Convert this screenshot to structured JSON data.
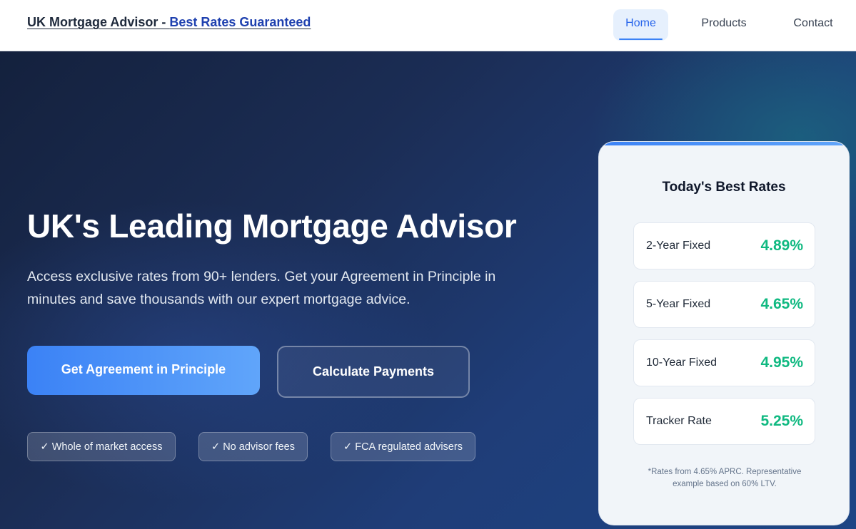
{
  "header": {
    "brand_prefix": "UK Mortgage Advisor - ",
    "brand_accent": "Best Rates Guaranteed",
    "nav": [
      {
        "label": "Home"
      },
      {
        "label": "Products"
      },
      {
        "label": "Contact"
      }
    ]
  },
  "hero": {
    "title": "UK's Leading Mortgage Advisor",
    "subtitle": "Access exclusive rates from 90+ lenders. Get your Agreement in Principle in minutes and save thousands with our expert mortgage advice.",
    "primary_button": "Get Agreement in Principle",
    "secondary_button": "Calculate Payments",
    "badges": [
      "✓ Whole of market access",
      "✓ No advisor fees",
      "✓ FCA regulated advisers"
    ]
  },
  "rates_card": {
    "title": "Today's Best Rates",
    "rates": [
      {
        "label": "2-Year Fixed",
        "value": "4.89%"
      },
      {
        "label": "5-Year Fixed",
        "value": "4.65%"
      },
      {
        "label": "10-Year Fixed",
        "value": "4.95%"
      },
      {
        "label": "Tracker Rate",
        "value": "5.25%"
      }
    ],
    "note": "*Rates from 4.65% APRC. Representative example based on 60% LTV."
  },
  "colors": {
    "accent": "#3b82f6",
    "rate_green": "#10b981",
    "hero_dark": "#14213d"
  }
}
